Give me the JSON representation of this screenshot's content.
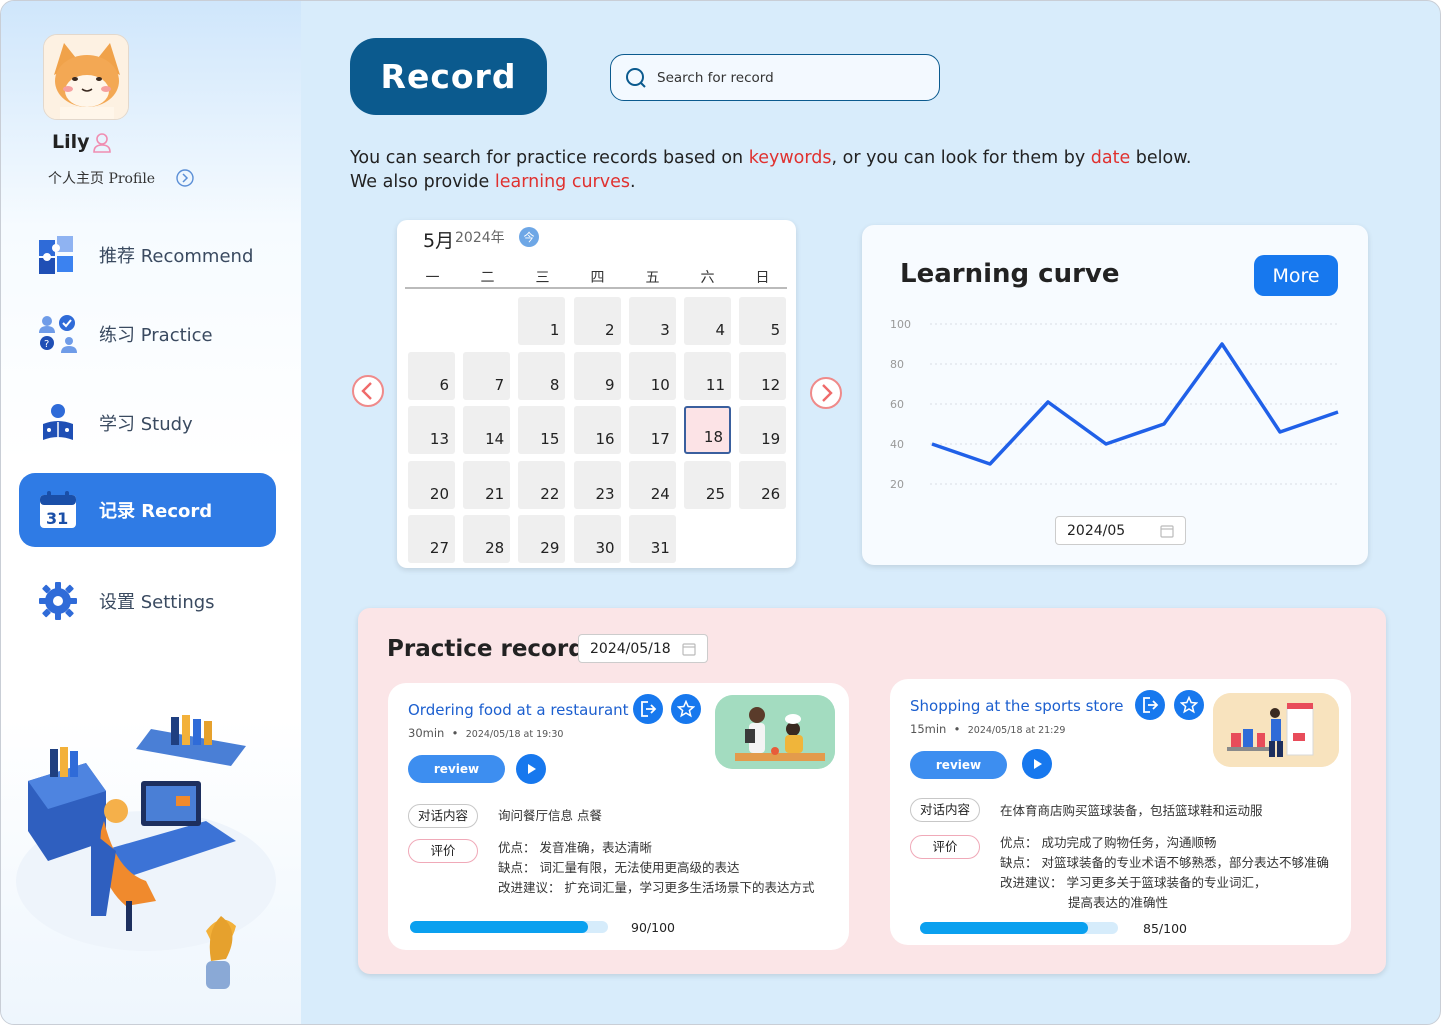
{
  "user": {
    "name": "Lily",
    "profile_link": "个人主页 Profile"
  },
  "nav": {
    "items": [
      {
        "label": "推荐 Recommend",
        "icon": "puzzle-icon"
      },
      {
        "label": "练习 Practice",
        "icon": "people-check-icon"
      },
      {
        "label": "学习 Study",
        "icon": "reading-person-icon"
      },
      {
        "label": "记录 Record",
        "icon": "calendar-31-icon",
        "active": true
      },
      {
        "label": "设置 Settings",
        "icon": "gear-icon"
      }
    ]
  },
  "header": {
    "title": "Record",
    "search_placeholder": "Search for record"
  },
  "description": {
    "line1_pre": "You can search for practice records based on ",
    "line1_kw1": "keywords",
    "line1_mid": ", or you can look for them by ",
    "line1_kw2": "date",
    "line1_post": " below.",
    "line2_pre": "We also provide ",
    "line2_kw": "learning curves",
    "line2_post": "."
  },
  "calendar": {
    "month": "5月",
    "year": "2024年",
    "today_label": "今",
    "weekdays": [
      "一",
      "二",
      "三",
      "四",
      "五",
      "六",
      "日"
    ],
    "days": [
      "1",
      "2",
      "3",
      "4",
      "5",
      "6",
      "7",
      "8",
      "9",
      "10",
      "11",
      "12",
      "13",
      "14",
      "15",
      "16",
      "17",
      "18",
      "19",
      "20",
      "21",
      "22",
      "23",
      "24",
      "25",
      "26",
      "27",
      "28",
      "29",
      "30",
      "31"
    ],
    "first_weekday_index": 2,
    "selected_day": 18
  },
  "learning_curve": {
    "title": "Learning curve",
    "more_label": "More",
    "date_value": "2024/05",
    "chart_data": {
      "type": "line",
      "y_ticks": [
        100,
        80,
        60,
        40,
        20
      ],
      "ylim": [
        0,
        100
      ],
      "values": [
        40,
        30,
        61,
        40,
        50,
        90,
        46,
        56
      ],
      "grid": true,
      "line_color": "#2060e8"
    }
  },
  "practice": {
    "title": "Practice record",
    "date_value": "2024/05/18",
    "records": [
      {
        "title": "Ordering food at a restaurant",
        "duration": "30min",
        "timestamp": "2024/05/18 at 19:30",
        "review_label": "review",
        "tag_content": "对话内容",
        "content": "询问餐厅信息 点餐",
        "tag_eval": "评价",
        "eval_lines": [
          "优点：  发音准确，表达清晰",
          "缺点：  词汇量有限，无法使用更高级的表达",
          "改进建议：  扩充词汇量，学习更多生活场景下的表达方式"
        ],
        "score_value": 90,
        "score_text": "90/100"
      },
      {
        "title": "Shopping at the sports store",
        "duration": "15min",
        "timestamp": "2024/05/18 at 21:29",
        "review_label": "review",
        "tag_content": "对话内容",
        "content": "在体育商店购买篮球装备，包括篮球鞋和运动服",
        "tag_eval": "评价",
        "eval_lines": [
          "优点：  成功完成了购物任务，沟通顺畅",
          "缺点：  对篮球装备的专业术语不够熟悉，部分表达不够准确",
          "改进建议：  学习更多关于篮球装备的专业词汇，",
          "提高表达的准确性"
        ],
        "score_value": 85,
        "score_text": "85/100"
      }
    ]
  },
  "colors": {
    "accent": "#1778ee",
    "highlight": "#e0312f",
    "title_bg": "#0b5a8e",
    "practice_bg": "#fbe5e7"
  }
}
